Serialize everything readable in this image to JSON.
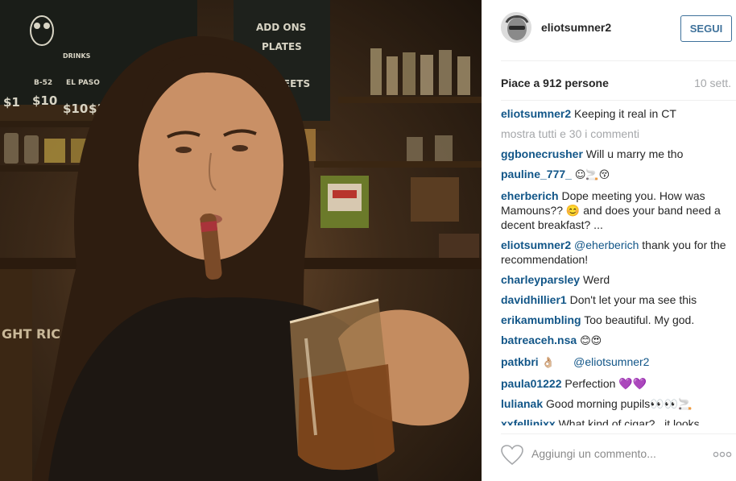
{
  "post": {
    "author": "eliotsumner2",
    "follow_label": "SEGUI",
    "likes_text": "Piace a 912 persone",
    "age_text": "10 sett.",
    "show_all_text": "mostra tutti e 30 i commenti",
    "add_comment_placeholder": "Aggiungi un commento...",
    "more_options_icon": "more-horizontal-icon",
    "like_icon": "heart-outline-icon"
  },
  "photo": {
    "chalkboard_lines": [
      "ADD ONS",
      "PLATES",
      "SWEETS",
      "DRINKS",
      "B-52",
      "EL PASO",
      "$10",
      "$10",
      "$10",
      "$1"
    ],
    "wall_text": "GHT RIC"
  },
  "comments": [
    {
      "user": "eliotsumner2",
      "text": "Keeping it real in CT"
    },
    {
      "user": "ggbonecrusher",
      "text": "Will u marry me tho"
    },
    {
      "user": "pauline_777_",
      "text": "☺🚬😚"
    },
    {
      "user": "eherberich",
      "text": "Dope meeting you. How was Mamouns?? 😊 and does your band need a decent breakfast? ..."
    },
    {
      "user": "eliotsumner2",
      "mention": "@eherberich",
      "text": "thank you for the recommendation!"
    },
    {
      "user": "charleyparsley",
      "text": "Werd"
    },
    {
      "user": "davidhillier1",
      "text": "Don't let your ma see this"
    },
    {
      "user": "erikamumbling",
      "text": "Too beautiful. My god."
    },
    {
      "user": "batreaceh.nsa",
      "text": "😊😍"
    },
    {
      "user": "patkbri",
      "text": "👌🏼",
      "mention": "@eliotsumner2"
    },
    {
      "user": "paula01222",
      "text": "Perfection 💜💜"
    },
    {
      "user": "lulianak",
      "text": "Good morning pupils👀👀🚬"
    },
    {
      "user": "xxfellinixx",
      "text": "What kind of cigar?...it looks"
    }
  ]
}
